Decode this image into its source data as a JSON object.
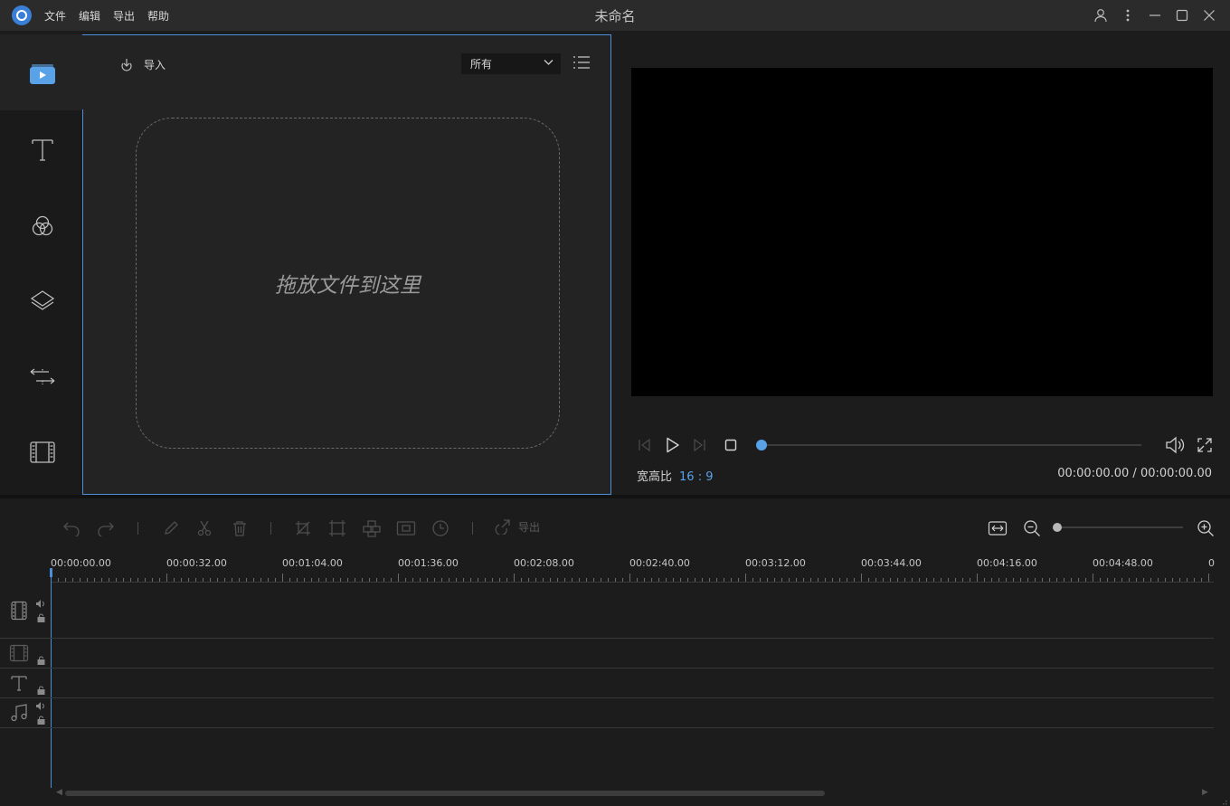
{
  "app": {
    "window_title": "未命名",
    "menu": [
      "文件",
      "编辑",
      "导出",
      "帮助"
    ]
  },
  "media": {
    "import_label": "导入",
    "filter_value": "所有",
    "drop_hint": "拖放文件到这里",
    "rail_icons": [
      "media-icon",
      "text-icon",
      "filters-icon",
      "overlays-icon",
      "transitions-icon",
      "film-elements-icon"
    ]
  },
  "preview": {
    "aspect_label": "宽高比",
    "aspect_value": "16 : 9",
    "timecode": "00:00:00.00 / 00:00:00.00",
    "seek_position": 0
  },
  "timeline": {
    "export_label": "导出",
    "zoom_level": 0,
    "ruler_labels": [
      "00:00:00.00",
      "00:00:32.00",
      "00:01:04.00",
      "00:01:36.00",
      "00:02:08.00",
      "00:02:40.00",
      "00:03:12.00",
      "00:03:44.00",
      "00:04:16.00",
      "00:04:48.00",
      "0"
    ]
  },
  "colors": {
    "accent": "#4a8fd8",
    "bg_dark": "#1c1c1c",
    "panel": "#232323"
  }
}
